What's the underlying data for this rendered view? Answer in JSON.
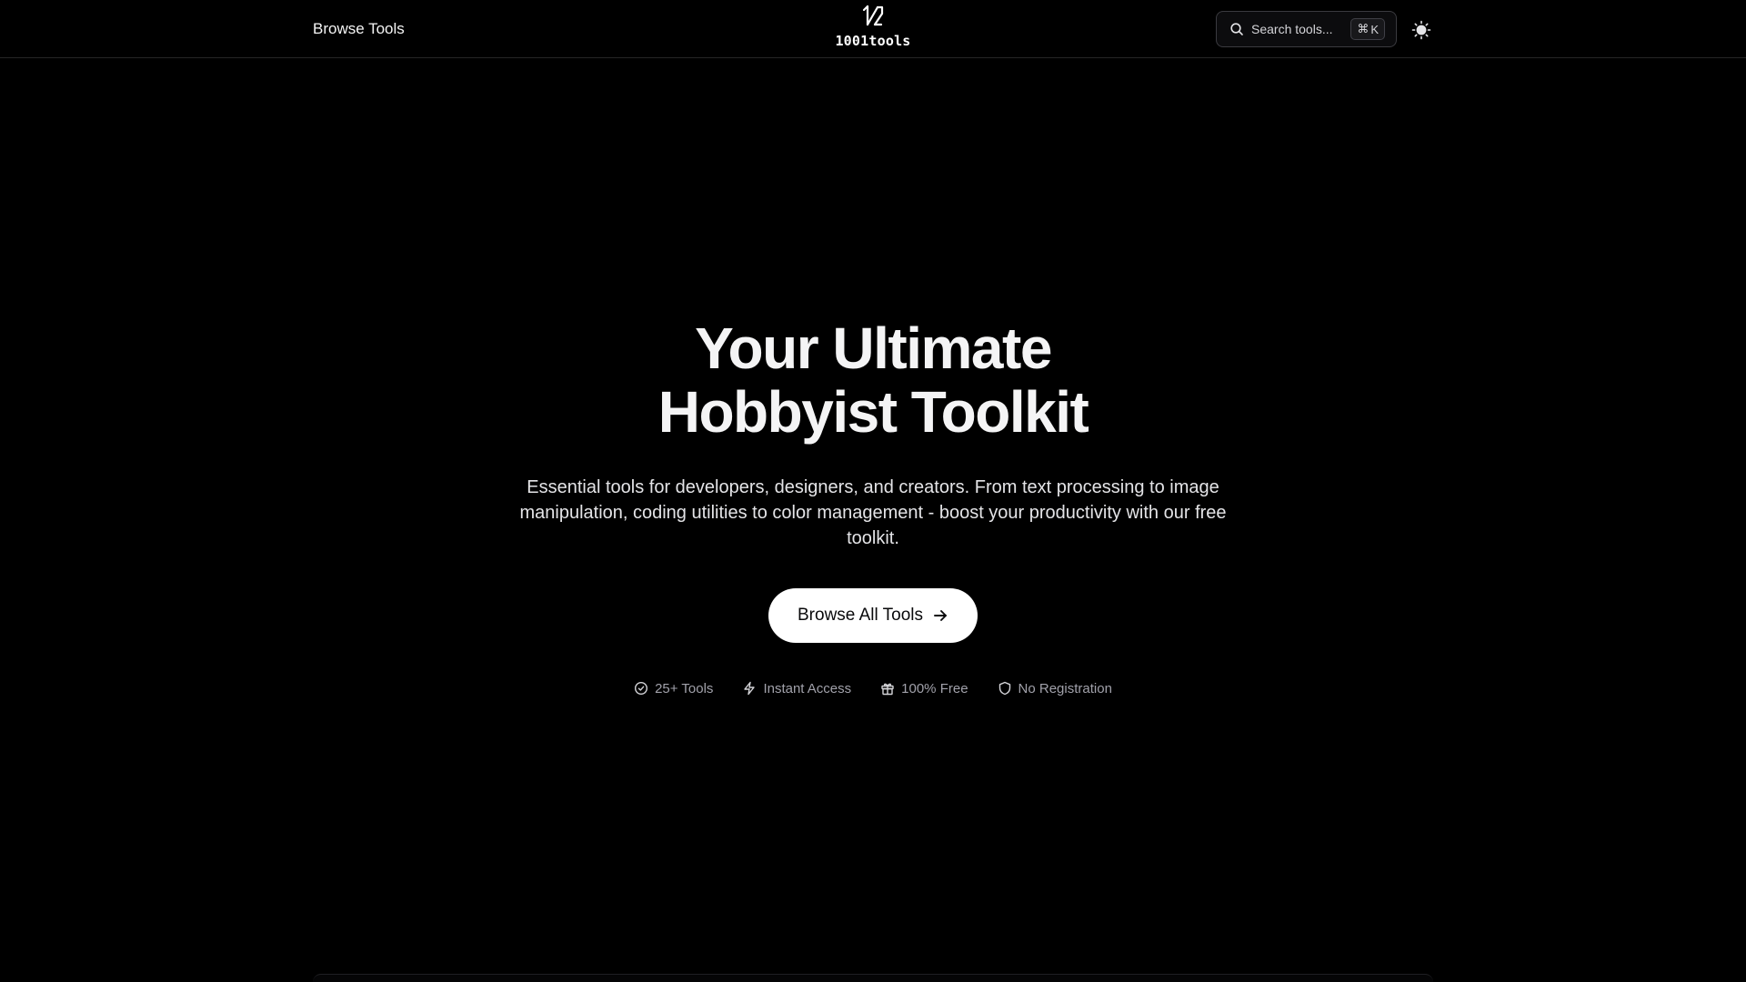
{
  "header": {
    "nav_link": "Browse Tools",
    "brand_name": "1001tools",
    "search": {
      "label": "Search tools...",
      "shortcut_symbol": "⌘",
      "shortcut_key": "K"
    },
    "theme_toggle_icon": "sun-icon"
  },
  "hero": {
    "title_line1": "Your Ultimate",
    "title_line2": "Hobbyist Toolkit",
    "subtitle": "Essential tools for developers, designers, and creators. From text processing to image manipulation, coding utilities to color management - boost your productivity with our free toolkit.",
    "cta_label": "Browse All Tools",
    "cta_icon": "arrow-right-icon"
  },
  "features": [
    {
      "icon": "check-circle-icon",
      "label": "25+ Tools"
    },
    {
      "icon": "zap-icon",
      "label": "Instant Access"
    },
    {
      "icon": "gift-icon",
      "label": "100% Free"
    },
    {
      "icon": "shield-icon",
      "label": "No Registration"
    }
  ],
  "colors": {
    "background": "#000000",
    "text_primary": "#f4f4f5",
    "text_muted": "#a1a1aa",
    "cta_background": "#ffffff"
  }
}
